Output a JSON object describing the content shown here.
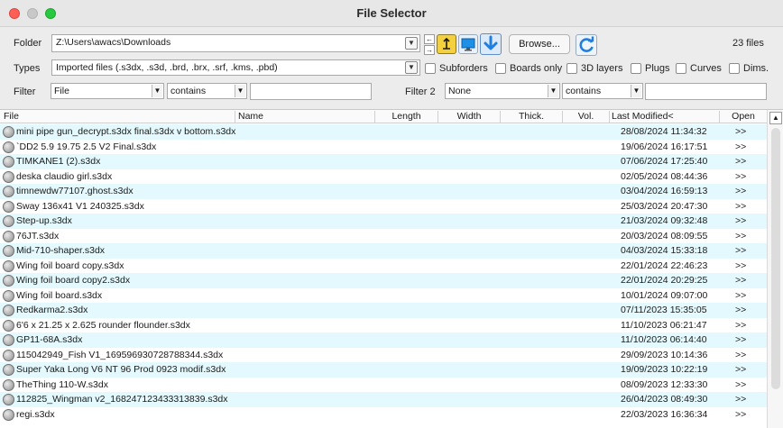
{
  "window": {
    "title": "File Selector"
  },
  "folder": {
    "label": "Folder",
    "value": "Z:\\Users\\awacs\\Downloads",
    "browse_label": "Browse...",
    "file_count": "23 files"
  },
  "types": {
    "label": "Types",
    "value": "Imported files (.s3dx, .s3d, .brd, .brx, .srf, .kms, .pbd)"
  },
  "options": [
    {
      "label": "Subforders"
    },
    {
      "label": "Boards only"
    },
    {
      "label": "3D layers"
    },
    {
      "label": "Plugs"
    },
    {
      "label": "Curves"
    },
    {
      "label": "Dims."
    }
  ],
  "filter1": {
    "label": "Filter",
    "field": "File",
    "op": "contains",
    "value": ""
  },
  "filter2": {
    "label": "Filter 2",
    "field": "None",
    "op": "contains",
    "value": ""
  },
  "columns": [
    "File",
    "Name",
    "Length",
    "Width",
    "Thick.",
    "Vol.",
    "Last Modified<",
    "Open"
  ],
  "rows": [
    {
      "file": "mini pipe gun_decrypt.s3dx final.s3dx v bottom.s3dx",
      "modified": "28/08/2024 11:34:32",
      "open": ">>"
    },
    {
      "file": "`DD2 5.9 19.75 2.5 V2 Final.s3dx",
      "modified": "19/06/2024 16:17:51",
      "open": ">>"
    },
    {
      "file": "TIMKANE1 (2).s3dx",
      "modified": "07/06/2024 17:25:40",
      "open": ">>"
    },
    {
      "file": "deska claudio girl.s3dx",
      "modified": "02/05/2024 08:44:36",
      "open": ">>"
    },
    {
      "file": "timnewdw77107.ghost.s3dx",
      "modified": "03/04/2024 16:59:13",
      "open": ">>"
    },
    {
      "file": "Sway 136x41 V1 240325.s3dx",
      "modified": "25/03/2024 20:47:30",
      "open": ">>"
    },
    {
      "file": "Step-up.s3dx",
      "modified": "21/03/2024 09:32:48",
      "open": ">>"
    },
    {
      "file": "76JT.s3dx",
      "modified": "20/03/2024 08:09:55",
      "open": ">>"
    },
    {
      "file": "Mid-710-shaper.s3dx",
      "modified": "04/03/2024 15:33:18",
      "open": ">>"
    },
    {
      "file": "Wing foil board copy.s3dx",
      "modified": "22/01/2024 22:46:23",
      "open": ">>"
    },
    {
      "file": "Wing foil board copy2.s3dx",
      "modified": "22/01/2024 20:29:25",
      "open": ">>"
    },
    {
      "file": "Wing foil board.s3dx",
      "modified": "10/01/2024 09:07:00",
      "open": ">>"
    },
    {
      "file": "Redkarma2.s3dx",
      "modified": "07/11/2023 15:35:05",
      "open": ">>"
    },
    {
      "file": "6'6 x 21.25 x 2.625 rounder flounder.s3dx",
      "modified": "11/10/2023 06:21:47",
      "open": ">>"
    },
    {
      "file": "GP11-68A.s3dx",
      "modified": "11/10/2023 06:14:40",
      "open": ">>"
    },
    {
      "file": "115042949_Fish V1_169596930728788344.s3dx",
      "modified": "29/09/2023 10:14:36",
      "open": ">>"
    },
    {
      "file": "Super Yaka Long V6 NT 96 Prod 0923 modif.s3dx",
      "modified": "19/09/2023 10:22:19",
      "open": ">>"
    },
    {
      "file": "TheThing 110-W.s3dx",
      "modified": "08/09/2023 12:33:30",
      "open": ">>"
    },
    {
      "file": "112825_Wingman v2_168247123433313839.s3dx",
      "modified": "26/04/2023 08:49:30",
      "open": ">>"
    },
    {
      "file": "regi.s3dx",
      "modified": "22/03/2023 16:36:34",
      "open": ">>"
    }
  ],
  "colors": {
    "row_alt": "#e3f9fd",
    "accent_blue": "#1f7fe0"
  }
}
